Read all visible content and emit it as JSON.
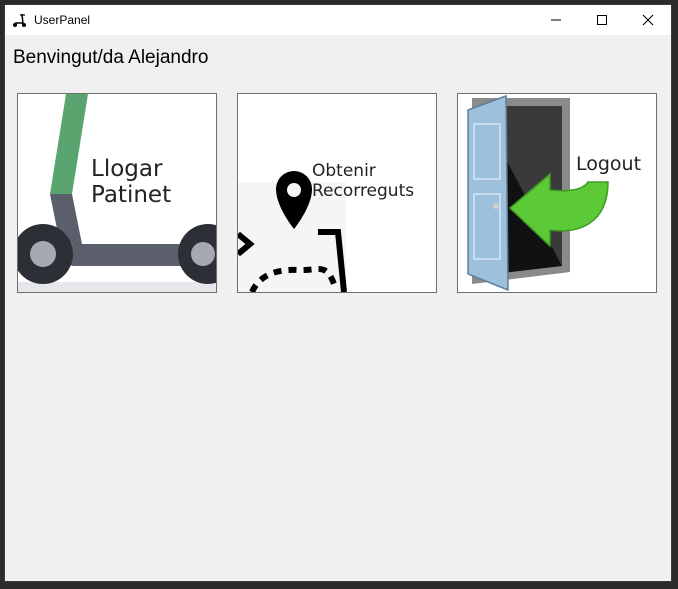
{
  "window": {
    "title": "UserPanel",
    "app_icon": "scooter-icon",
    "controls": [
      "minimize-icon",
      "maximize-icon",
      "close-icon"
    ]
  },
  "main": {
    "welcome_text": "Benvingut/da Alejandro",
    "tiles": [
      {
        "line1": "Llogar",
        "line2": "Patinet",
        "icon": "scooter-icon"
      },
      {
        "line1": "Obtenir",
        "line2": "Recorreguts",
        "icon": "map-pin-route-icon"
      },
      {
        "line1": "Logout",
        "icon": "door-exit-icon"
      }
    ]
  },
  "colors": {
    "scooter_stem": "#5aa46f",
    "scooter_body": "#5b5e6b",
    "logout_arrow": "#5cc936",
    "door": "#9dc0dc"
  }
}
